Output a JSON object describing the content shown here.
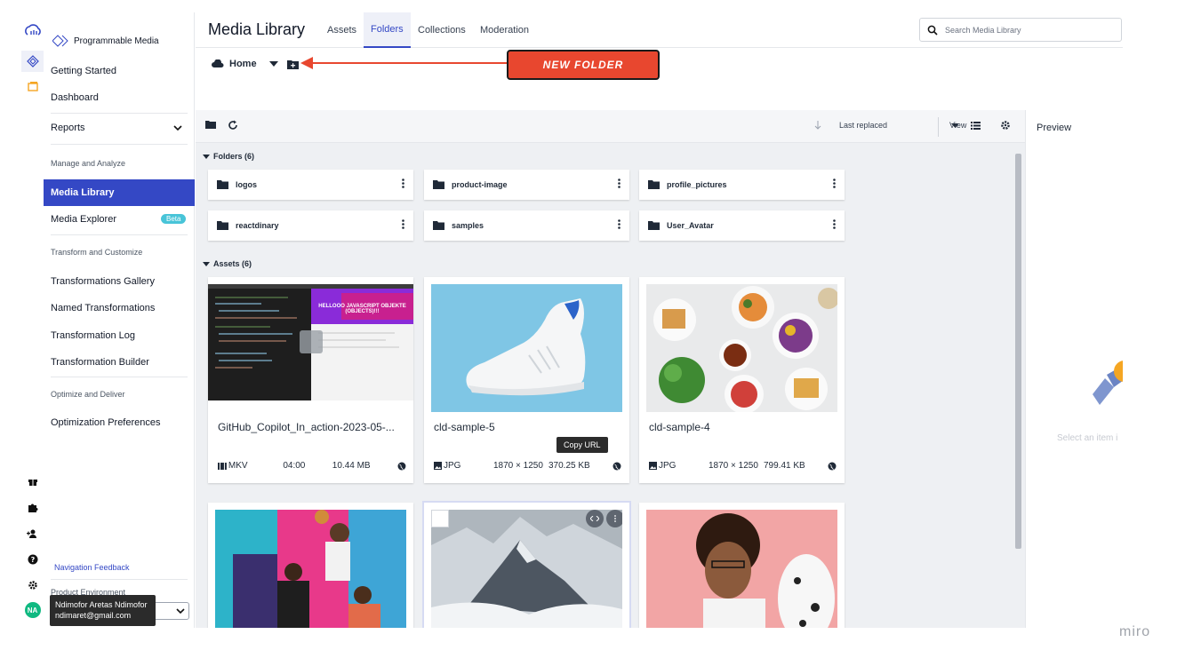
{
  "sidebar": {
    "brand": "Programmable Media",
    "getting_started": "Getting Started",
    "dashboard": "Dashboard",
    "reports": "Reports",
    "section_manage": "Manage and Analyze",
    "media_library": "Media Library",
    "media_explorer": "Media Explorer",
    "beta": "Beta",
    "section_transform": "Transform and Customize",
    "transformations_gallery": "Transformations Gallery",
    "named_transformations": "Named Transformations",
    "transformation_log": "Transformation Log",
    "transformation_builder": "Transformation Builder",
    "section_optimize": "Optimize and Deliver",
    "optimization_preferences": "Optimization Preferences",
    "navigation_feedback": "Navigation Feedback",
    "product_environment": "Product Environment",
    "user_name": "Ndimofor Aretas Ndimofor",
    "user_email": "ndimaret@gmail.com",
    "avatar_initials": "NA"
  },
  "header": {
    "title": "Media Library",
    "tabs": [
      "Assets",
      "Folders",
      "Collections",
      "Moderation"
    ],
    "active_tab": "Folders",
    "search_placeholder": "Search Media Library"
  },
  "breadcrumb": {
    "home": "Home"
  },
  "callout": {
    "text": "NEW FOLDER",
    "color": "#e8472f"
  },
  "toolbar": {
    "sort": "Last replaced",
    "view": "View"
  },
  "folders": {
    "title": "Folders (6)",
    "items": [
      "logos",
      "product-image",
      "profile_pictures",
      "reactdinary",
      "samples",
      "User_Avatar"
    ]
  },
  "assets": {
    "title": "Assets (6)",
    "items": [
      {
        "name": "GitHub_Copilot_In_action-2023-05-...",
        "type": "MKV",
        "dim": "04:00",
        "size": "10.44 MB"
      },
      {
        "name": "cld-sample-5",
        "type": "JPG",
        "dim": "1870 × 1250",
        "size": "370.25 KB"
      },
      {
        "name": "cld-sample-4",
        "type": "JPG",
        "dim": "1870 × 1250",
        "size": "799.41 KB"
      }
    ],
    "overlay_text": "HELLOOO JAVASCRIPT OBJEKTE (OBJECTS)!!!",
    "copy_url": "Copy URL"
  },
  "preview": {
    "title": "Preview",
    "hint": "Select an item i"
  },
  "watermark": "miro",
  "colors": {
    "accent": "#3448c5",
    "beta": "#48c4d8",
    "callout": "#e8472f"
  }
}
